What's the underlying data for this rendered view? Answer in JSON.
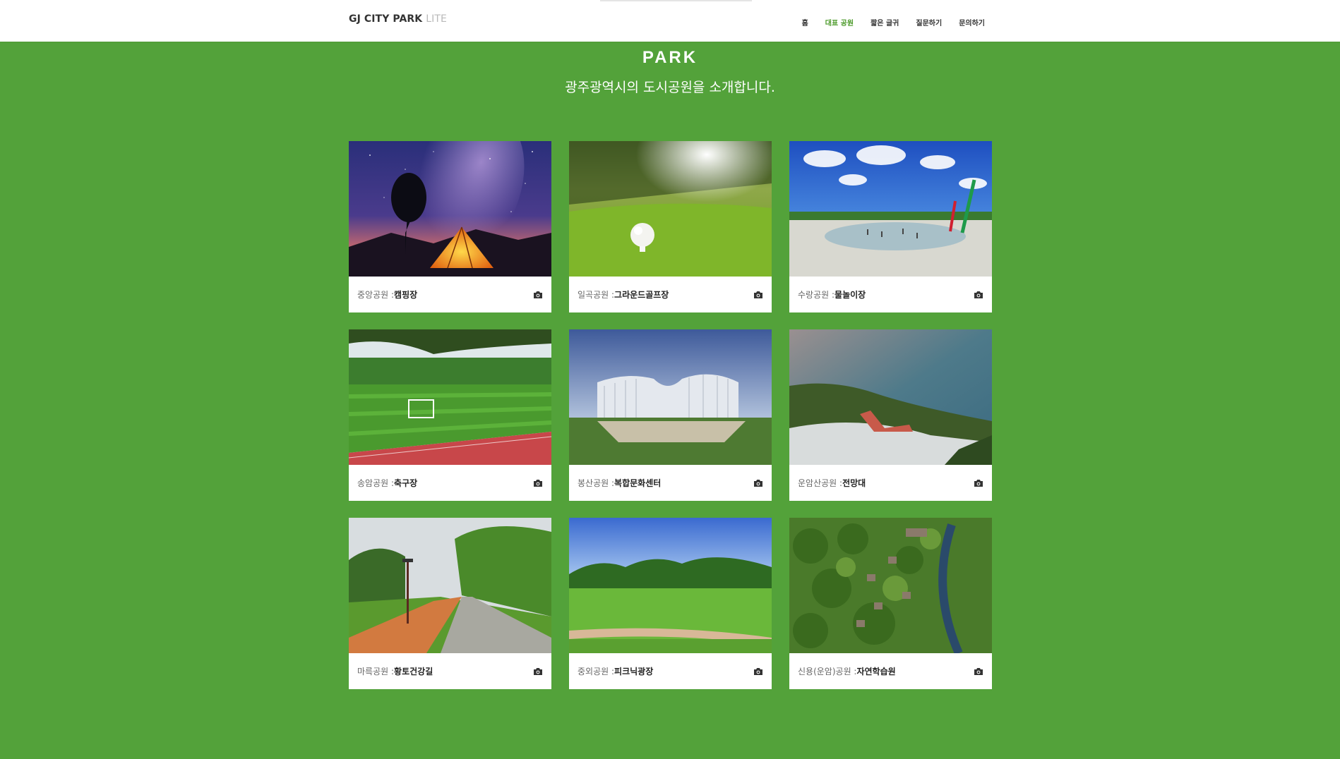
{
  "header": {
    "brand": "GJ CITY PARK",
    "brand_suffix": "LITE",
    "nav": [
      {
        "label": "홈",
        "active": false
      },
      {
        "label": "대표 공원",
        "active": true
      },
      {
        "label": "짧은 글귀",
        "active": false
      },
      {
        "label": "질문하기",
        "active": false
      },
      {
        "label": "문의하기",
        "active": false
      }
    ]
  },
  "hero": {
    "title": "PARK",
    "subtitle": "광주광역시의 도시공원을 소개합니다."
  },
  "cards": [
    {
      "place": "중앙공원 :",
      "feature": "캠핑장",
      "image": "night-camping-tent"
    },
    {
      "place": "일곡공원 :",
      "feature": "그라운드골프장",
      "image": "golf-ball-on-grass"
    },
    {
      "place": "수랑공원 :",
      "feature": "물놀이장",
      "image": "water-playground"
    },
    {
      "place": "송암공원 :",
      "feature": "축구장",
      "image": "soccer-field"
    },
    {
      "place": "봉산공원 :",
      "feature": "복합문화센터",
      "image": "culture-center-building"
    },
    {
      "place": "운암산공원 :",
      "feature": "전망대",
      "image": "observation-deck"
    },
    {
      "place": "마륵공원 :",
      "feature": "황토건강길",
      "image": "red-clay-path"
    },
    {
      "place": "중외공원 :",
      "feature": "피크닉광장",
      "image": "picnic-lawn"
    },
    {
      "place": "신용(운암)공원 :",
      "feature": "자연학습원",
      "image": "nature-learning-aerial"
    }
  ],
  "colors": {
    "background": "#53a23a",
    "active_nav": "#4c9a2a"
  },
  "icons": {
    "caption": "camera-icon"
  }
}
